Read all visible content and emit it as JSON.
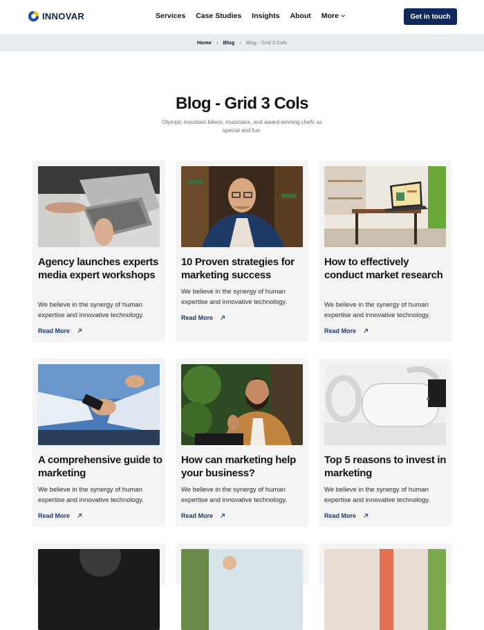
{
  "header": {
    "brand": "INNOVAR",
    "nav": [
      "Services",
      "Case Studies",
      "Insights",
      "About",
      "More"
    ],
    "cta": "Get in touch"
  },
  "breadcrumb": {
    "home": "Home",
    "blog": "Blog",
    "current": "Blog - Grid 3 Cols"
  },
  "hero": {
    "title": "Blog - Grid 3 Cols",
    "subtitle": "Olympic mountain bikers, musicians, and award-winning chefs so special and fun."
  },
  "posts": [
    {
      "title": "Agency launches experts media expert workshops",
      "text": "We believe in the synergy of human expertise and innovative technology.",
      "link": "Read More"
    },
    {
      "title": "10 Proven strategies for marketing success",
      "text": "We believe in the synergy of human expertise and innovative technology.",
      "link": "Read More"
    },
    {
      "title": "How to effectively conduct market research",
      "text": "We believe in the synergy of human expertise and innovative technology.",
      "link": "Read More"
    },
    {
      "title": "A comprehensive guide to marketing",
      "text": "We believe in the synergy of human expertise and innovative technology.",
      "link": "Read More"
    },
    {
      "title": "How can marketing help your business?",
      "text": "We believe in the synergy of human expertise and innovative technology.",
      "link": "Read More"
    },
    {
      "title": "Top 5 reasons to invest in marketing",
      "text": "We believe in the synergy of human expertise and innovative technology.",
      "link": "Read More"
    }
  ],
  "colors": {
    "brand_navy": "#0e2a5c",
    "link_blue": "#1a3a6b",
    "card_bg": "#f4f4f4",
    "breadcrumb_bg": "#e8ebef"
  },
  "icons": [
    "innovar-logo-icon",
    "chevron-down-icon",
    "chevron-right-icon",
    "arrow-up-right-icon"
  ]
}
